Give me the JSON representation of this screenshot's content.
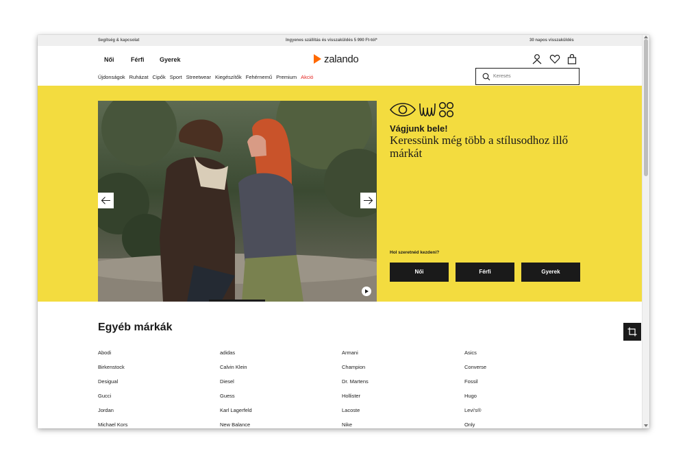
{
  "topbar": {
    "help": "Segítség & kapcsolat",
    "shipping": "Ingyenes szállítás és visszaküldés 5 990 Ft-tól*",
    "returns": "30 napos visszaküldés"
  },
  "header": {
    "genders": [
      "Női",
      "Férfi",
      "Gyerek"
    ],
    "logo_text": "zalando",
    "logo_color": "#ff6900",
    "icons": [
      "user-icon",
      "heart-icon",
      "bag-icon"
    ]
  },
  "categories": [
    {
      "label": "Újdonságok"
    },
    {
      "label": "Ruházat"
    },
    {
      "label": "Cipők"
    },
    {
      "label": "Sport"
    },
    {
      "label": "Streetwear"
    },
    {
      "label": "Kiegészítők"
    },
    {
      "label": "Fehérnemű"
    },
    {
      "label": "Premium"
    },
    {
      "label": "Akció",
      "color": "#e4231f"
    }
  ],
  "search": {
    "placeholder": "Keresés"
  },
  "banner": {
    "background": "#f3dc3f",
    "headline": "Vágjunk bele!",
    "subline": "Keressünk még több a stílusodhoz illő márkát",
    "prompt": "Hol szeretnéd kezdeni?",
    "buttons": [
      "Női",
      "Férfi",
      "Gyerek"
    ]
  },
  "brands": {
    "title": "Egyéb márkák",
    "columns": [
      [
        "Abodi",
        "Birkenstock",
        "Desigual",
        "Gucci",
        "Jordan",
        "Michael Kors"
      ],
      [
        "adidas",
        "Calvin Klein",
        "Diesel",
        "Guess",
        "Karl Lagerfeld",
        "New Balance"
      ],
      [
        "Armani",
        "Champion",
        "Dr. Martens",
        "Hollister",
        "Lacoste",
        "Nike"
      ],
      [
        "Asics",
        "Converse",
        "Fossil",
        "Hugo",
        "Levi's®",
        "Only"
      ]
    ]
  }
}
